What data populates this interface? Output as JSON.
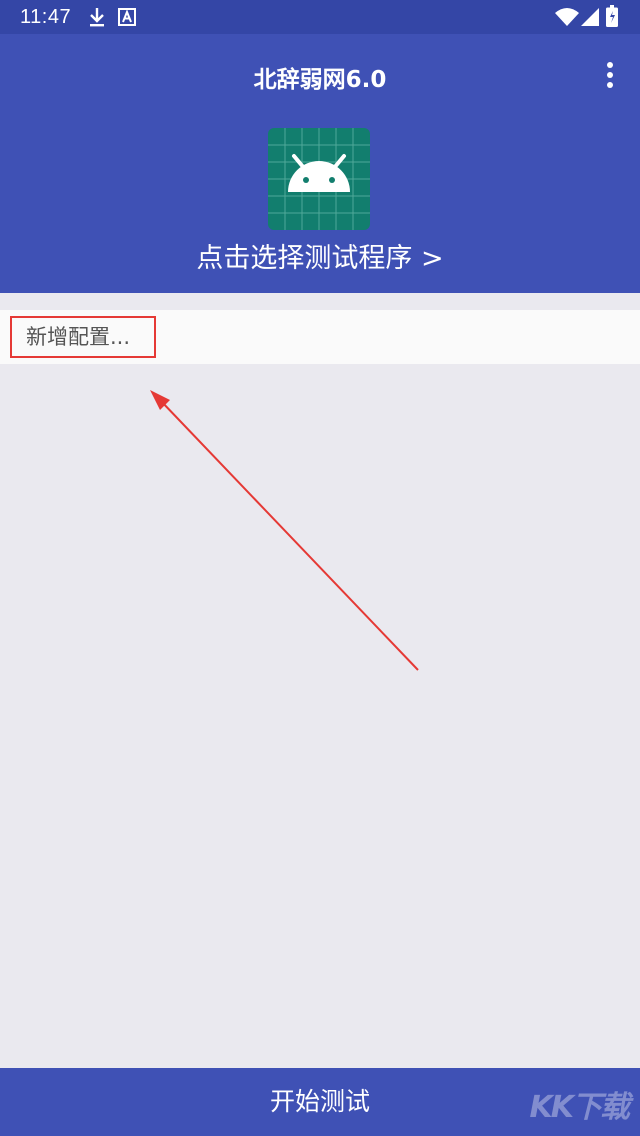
{
  "status_bar": {
    "time": "11:47",
    "icons": [
      "download-icon",
      "a-icon",
      "wifi-icon",
      "signal-icon",
      "battery-icon"
    ]
  },
  "app_bar": {
    "title": "北辞弱网6.0",
    "select_program_label": "点击选择测试程序 >",
    "menu_icon": "more-vert-icon",
    "app_icon": "android-icon"
  },
  "config": {
    "add_label": "新增配置..."
  },
  "bottom": {
    "start_label": "开始测试"
  },
  "watermark": {
    "text": "KK下载"
  },
  "colors": {
    "primary": "#3f51b5",
    "status_bar": "#3446a6",
    "background": "#eae9ef",
    "highlight": "#e53935",
    "icon_bg": "#127e6e"
  }
}
